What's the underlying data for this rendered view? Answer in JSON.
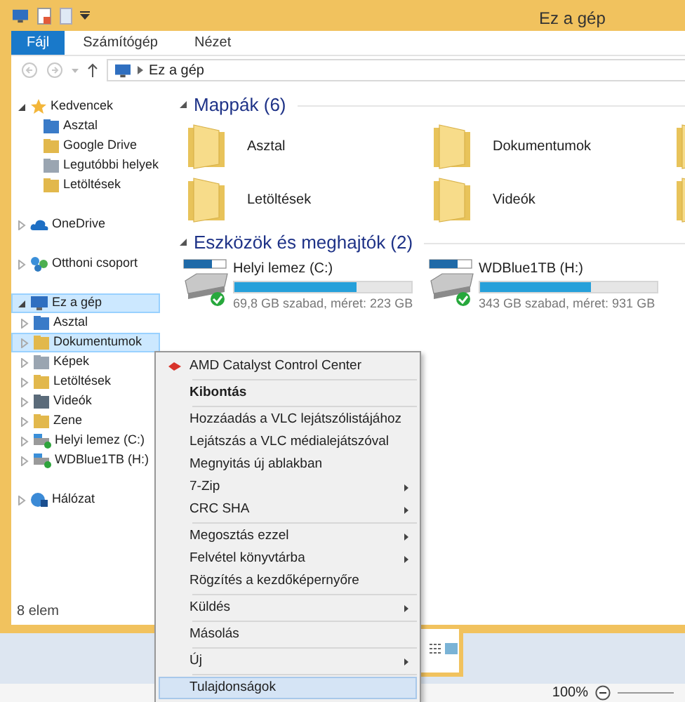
{
  "window": {
    "title": "Ez a gép"
  },
  "ribbon_tabs": [
    {
      "label": "Fájl",
      "selected": true
    },
    {
      "label": "Számítógép",
      "selected": false
    },
    {
      "label": "Nézet",
      "selected": false
    }
  ],
  "address": {
    "path": "Ez a gép"
  },
  "nav": [
    {
      "label": "Kedvencek",
      "expanded": true,
      "selected": false,
      "children": [
        {
          "label": "Asztal",
          "selected": false
        },
        {
          "label": "Google Drive",
          "selected": false
        },
        {
          "label": "Legutóbbi helyek",
          "selected": false
        },
        {
          "label": "Letöltések",
          "selected": false
        }
      ]
    },
    {
      "label": "OneDrive",
      "expanded": false,
      "selected": false
    },
    {
      "label": "Otthoni csoport",
      "expanded": false,
      "selected": false
    },
    {
      "label": "Ez a gép",
      "expanded": true,
      "selected": true,
      "children": [
        {
          "label": "Asztal",
          "expanded": false,
          "selected": false
        },
        {
          "label": "Dokumentumok",
          "expanded": false,
          "selected": true
        },
        {
          "label": "Képek",
          "expanded": false,
          "selected": false
        },
        {
          "label": "Letöltések",
          "expanded": false,
          "selected": false
        },
        {
          "label": "Videók",
          "expanded": false,
          "selected": false
        },
        {
          "label": "Zene",
          "expanded": false,
          "selected": false
        },
        {
          "label": "Helyi lemez (C:)",
          "expanded": false,
          "selected": false
        },
        {
          "label": "WDBlue1TB (H:)",
          "expanded": false,
          "selected": false
        }
      ]
    },
    {
      "label": "Hálózat",
      "expanded": false,
      "selected": false
    }
  ],
  "folders": {
    "heading": "Mappák (6)",
    "items": [
      {
        "label": "Asztal"
      },
      {
        "label": "Dokumentumok"
      },
      {
        "label": "Letöltések"
      },
      {
        "label": "Videók"
      }
    ]
  },
  "drives": {
    "heading": "Eszközök és meghajtók (2)",
    "items": [
      {
        "label": "Helyi lemez (C:)",
        "level": 0.69,
        "info": "69,8 GB szabad, méret: 223 GB"
      },
      {
        "label": "WDBlue1TB (H:)",
        "level": 0.63,
        "info": "343 GB szabad, méret: 931 GB"
      }
    ]
  },
  "status_bar": {
    "count": "8 elem"
  },
  "context_menu": [
    [
      {
        "label": "AMD Catalyst Control Center",
        "icon": true,
        "bold": false,
        "submenu": false,
        "selected": false
      }
    ],
    [
      {
        "label": "Kibontás",
        "icon": false,
        "bold": true,
        "submenu": false,
        "selected": false
      }
    ],
    [
      {
        "label": "Hozzáadás a VLC lejátszólistájához",
        "icon": false,
        "bold": false,
        "submenu": false,
        "selected": false
      },
      {
        "label": "Lejátszás a VLC médialejátszóval",
        "icon": false,
        "bold": false,
        "submenu": false,
        "selected": false
      },
      {
        "label": "Megnyitás új ablakban",
        "icon": false,
        "bold": false,
        "submenu": false,
        "selected": false
      },
      {
        "label": "7-Zip",
        "icon": false,
        "bold": false,
        "submenu": true,
        "selected": false
      },
      {
        "label": "CRC SHA",
        "icon": false,
        "bold": false,
        "submenu": true,
        "selected": false
      }
    ],
    [
      {
        "label": "Megosztás ezzel",
        "icon": false,
        "bold": false,
        "submenu": true,
        "selected": false
      },
      {
        "label": "Felvétel könyvtárba",
        "icon": false,
        "bold": false,
        "submenu": true,
        "selected": false
      },
      {
        "label": "Rögzítés a kezdőképernyőre",
        "icon": false,
        "bold": false,
        "submenu": false,
        "selected": false
      }
    ],
    [
      {
        "label": "Küldés",
        "icon": false,
        "bold": false,
        "submenu": true,
        "selected": false
      }
    ],
    [
      {
        "label": "Másolás",
        "icon": false,
        "bold": false,
        "submenu": false,
        "selected": false
      }
    ],
    [
      {
        "label": "Új",
        "icon": false,
        "bold": false,
        "submenu": true,
        "selected": false
      }
    ],
    [
      {
        "label": "Tulajdonságok",
        "icon": false,
        "bold": false,
        "submenu": false,
        "selected": true
      }
    ]
  ],
  "zoom": {
    "value": "100%"
  }
}
